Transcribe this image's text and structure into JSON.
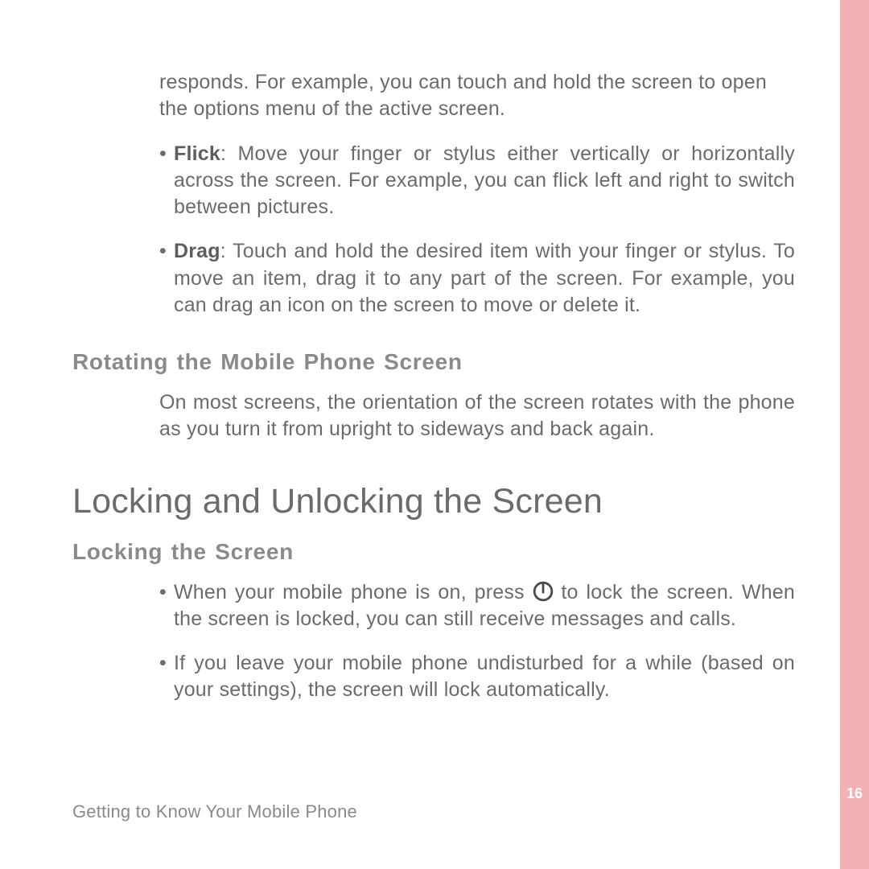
{
  "sidebar": {
    "page_number": "16"
  },
  "continued_para": "responds. For example, you can touch and hold the screen to open the options menu of the active screen.",
  "gesture_bullets": [
    {
      "term": "Flick",
      "text": ": Move your finger or stylus either vertically or horizontally across the screen. For example, you can flick left and right to switch between pictures."
    },
    {
      "term": "Drag",
      "text": ": Touch and hold the desired item with your finger or stylus. To move an item, drag it to any part of the screen. For example, you can drag an icon on the screen to move or delete it."
    }
  ],
  "rotating": {
    "heading": "Rotating the Mobile Phone Screen",
    "body": "On most screens, the orientation of the screen rotates with the phone as you turn it from upright to sideways and back again."
  },
  "lock_section": {
    "heading": "Locking and Unlocking the Screen",
    "sub1": {
      "heading": "Locking the Screen",
      "bullets": {
        "b1_pre": "When your mobile phone is on, press ",
        "b1_post": " to lock the screen. When the screen is locked, you can still receive messages and calls.",
        "b2": "If you leave your mobile phone undisturbed for a while (based on your settings), the screen will lock automatically."
      }
    }
  },
  "footer": "Getting to Know Your Mobile Phone"
}
